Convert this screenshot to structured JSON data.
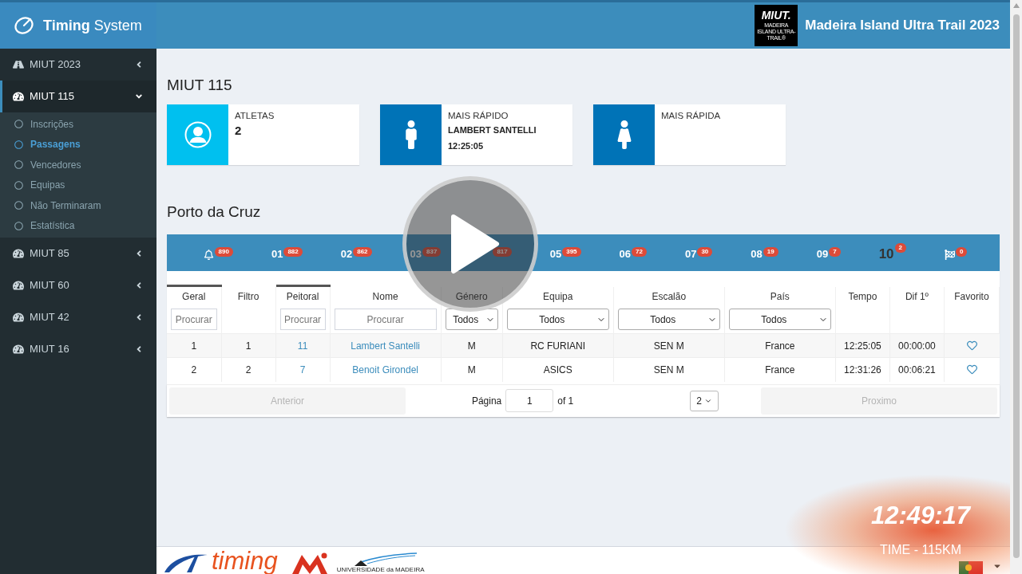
{
  "header": {
    "logo": "**Timing** System",
    "event_logo": {
      "mark": "MIUT.",
      "subtitle": "MADEIRA ISLAND ULTRA-TRAIL®"
    },
    "title": "Madeira Island Ultra Trail 2023"
  },
  "sidebar": {
    "items": [
      {
        "label": "MIUT 2023",
        "kind": "road",
        "active": false,
        "expanded": false
      },
      {
        "label": "MIUT 115",
        "kind": "gauge",
        "active": true,
        "expanded": true,
        "children": [
          {
            "label": "Inscrições",
            "selected": false
          },
          {
            "label": "Passagens",
            "selected": true
          },
          {
            "label": "Vencedores",
            "selected": false
          },
          {
            "label": "Equipas",
            "selected": false
          },
          {
            "label": "Não Terminaram",
            "selected": false
          },
          {
            "label": "Estatística",
            "selected": false
          }
        ]
      },
      {
        "label": "MIUT 85",
        "kind": "gauge",
        "active": false,
        "expanded": false
      },
      {
        "label": "MIUT 60",
        "kind": "gauge",
        "active": false,
        "expanded": false
      },
      {
        "label": "MIUT 42",
        "kind": "gauge",
        "active": false,
        "expanded": false
      },
      {
        "label": "MIUT 16",
        "kind": "gauge",
        "active": false,
        "expanded": false
      }
    ]
  },
  "page_title": "MIUT 115",
  "stat_boxes": [
    {
      "kind": "user",
      "color": "#00c0ef",
      "label": "ATLETAS",
      "value": "2"
    },
    {
      "kind": "male",
      "color": "#0073b7",
      "label": "MAIS RÁPIDO",
      "name": "LAMBERT SANTELLI",
      "time": "12:25:05"
    },
    {
      "kind": "female",
      "color": "#0073b7",
      "label": "MAIS RÁPIDA"
    }
  ],
  "section_title": "Porto da Cruz",
  "checkpoints": [
    {
      "kind": "bell",
      "badge": "890",
      "selected": false
    },
    {
      "kind": "number",
      "label": "01",
      "badge": "882",
      "selected": false
    },
    {
      "kind": "number",
      "label": "02",
      "badge": "862",
      "selected": false
    },
    {
      "kind": "number",
      "label": "03",
      "badge": "837",
      "selected": false
    },
    {
      "kind": "number",
      "badge": "817",
      "selected": false
    },
    {
      "kind": "number",
      "label": "05",
      "badge": "395",
      "selected": false
    },
    {
      "kind": "number",
      "label": "06",
      "badge": "72",
      "selected": false
    },
    {
      "kind": "number",
      "label": "07",
      "badge": "30",
      "selected": false
    },
    {
      "kind": "number",
      "label": "08",
      "badge": "19",
      "selected": false
    },
    {
      "kind": "number",
      "label": "09",
      "badge": "7",
      "selected": false
    },
    {
      "kind": "number",
      "label": "10",
      "badge": "2",
      "selected": true
    },
    {
      "kind": "flag",
      "badge": "0",
      "selected": false
    }
  ],
  "table": {
    "columns": [
      {
        "label": "Geral",
        "sorted": true,
        "kind": "text",
        "filter": {
          "kind": "text",
          "placeholder": "Procurar"
        }
      },
      {
        "label": "Filtro",
        "sorted": false,
        "kind": "text"
      },
      {
        "label": "Peitoral",
        "sorted": true,
        "kind": "link",
        "filter": {
          "kind": "text",
          "placeholder": "Procurar"
        }
      },
      {
        "label": "Nome",
        "sorted": false,
        "kind": "link",
        "filter": {
          "kind": "text",
          "placeholder": "Procurar"
        }
      },
      {
        "label": "Género",
        "sorted": false,
        "kind": "text",
        "filter": {
          "kind": "select",
          "value": "Todos"
        }
      },
      {
        "label": "Equipa",
        "sorted": false,
        "kind": "text",
        "filter": {
          "kind": "select",
          "value": "Todos"
        }
      },
      {
        "label": "Escalão",
        "sorted": false,
        "kind": "text",
        "filter": {
          "kind": "select",
          "value": "Todos"
        }
      },
      {
        "label": "País",
        "sorted": false,
        "kind": "text",
        "filter": {
          "kind": "select",
          "value": "Todos"
        }
      },
      {
        "label": "Tempo",
        "sorted": false,
        "kind": "text"
      },
      {
        "label": "Dif 1º",
        "sorted": false,
        "kind": "text"
      },
      {
        "label": "Favorito",
        "sorted": false,
        "kind": "favorite"
      }
    ],
    "rows": [
      {
        "cells": [
          "1",
          "1",
          "11",
          "Lambert Santelli",
          "M",
          "RC FURIANI",
          "SEN M",
          "France",
          "12:25:05",
          "00:00:00"
        ],
        "favorite": false
      },
      {
        "cells": [
          "2",
          "2",
          "7",
          "Benoit Girondel",
          "M",
          "ASICS",
          "SEN M",
          "France",
          "12:31:26",
          "00:06:21"
        ],
        "favorite": false
      }
    ]
  },
  "pagination": {
    "previous": {
      "label": "Anterior",
      "disabled": true
    },
    "page_label": "Página",
    "page": "1",
    "page_count": "of 1",
    "page_size": "2",
    "next": {
      "label": "Proximo",
      "disabled": true
    }
  },
  "footer": {
    "timing_logo": "timing",
    "university": "UNIVERSIDADE da MADEIRA"
  },
  "player": {
    "paused": true
  },
  "clock": {
    "time": "12:49:17",
    "label": "TIME - 115KM"
  }
}
